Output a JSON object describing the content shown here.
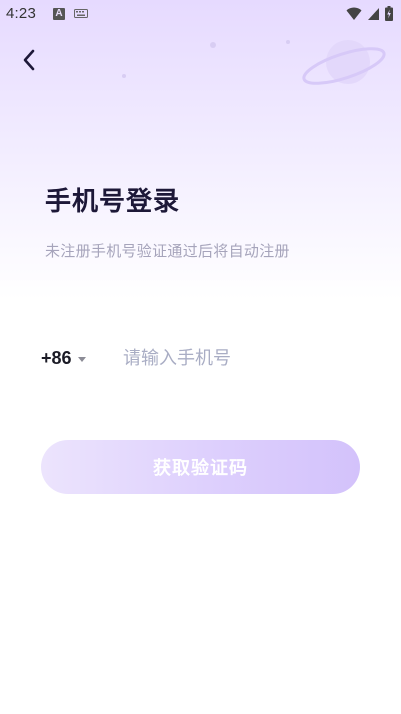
{
  "status_bar": {
    "time": "4:23",
    "notification_icon_letter": "A",
    "icons": [
      "a-notification-icon",
      "keyboard-icon",
      "wifi-icon",
      "signal-icon",
      "battery-charging-icon"
    ]
  },
  "header": {
    "back_icon": "chevron-left-icon"
  },
  "login": {
    "title": "手机号登录",
    "subtitle": "未注册手机号验证通过后将自动注册",
    "country_code": "+86",
    "phone_placeholder": "请输入手机号",
    "phone_value": "",
    "submit_label": "获取验证码"
  },
  "colors": {
    "gradient_top": "#e6daff",
    "title": "#1d1838",
    "subtitle": "#a6a4bb",
    "placeholder": "#a9adc4",
    "button_start": "#ece4fd",
    "button_end": "#d3c2fb"
  }
}
